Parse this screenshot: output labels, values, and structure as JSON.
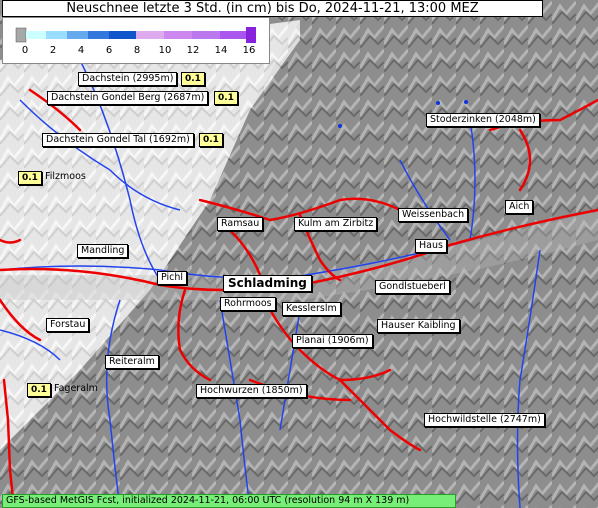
{
  "title": "Neuschnee letzte 3 Std. (in cm) bis Do, 2024-11-21, 13:00 MEZ",
  "legend": {
    "ticks": [
      "0",
      "2",
      "4",
      "6",
      "8",
      "10",
      "12",
      "14",
      "16"
    ],
    "colors": [
      "#a8a8a8",
      "#ccffff",
      "#99ddff",
      "#66aaee",
      "#3377dd",
      "#1155cc",
      "#ddaaee",
      "#cc88ee",
      "#aa55ee",
      "#8822dd"
    ]
  },
  "places": {
    "dachstein": "Dachstein (2995m)",
    "dachstein_gondel_berg": "Dachstein Gondel Berg (2687m)",
    "dachstein_gondel_tal": "Dachstein Gondel Tal (1692m)",
    "filzmoos": "Filzmoos",
    "stoderzinken": "Stoderzinken (2048m)",
    "ramsau": "Ramsau",
    "kulm": "Kulm am Zirbitz",
    "weissenbach": "Weissenbach",
    "aich": "Aich",
    "mandling": "Mandling",
    "haus": "Haus",
    "pichl": "Pichl",
    "schladming": "Schladming",
    "gondlstueberl": "Gondlstueberl",
    "rohrmoos": "Rohrmoos",
    "kesslerslm": "Kesslerslm",
    "forstau": "Forstau",
    "hauser_kaibling": "Hauser Kaibling",
    "planai": "Planai (1906m)",
    "reiteralm": "Reiteralm",
    "fageralm": "Fageralm",
    "hochwurzen": "Hochwurzen (1850m)",
    "hochwildstelle": "Hochwildstelle (2747m)"
  },
  "values": {
    "dachstein": "0.1",
    "dachstein_gondel_berg": "0.1",
    "dachstein_gondel_tal": "0.1",
    "filzmoos": "0.1",
    "fageralm": "0.1"
  },
  "footer": "GFS-based MetGIS Fcst, initialized 2024-11-21, 06:00 UTC  (resolution 94 m X 139 m)"
}
